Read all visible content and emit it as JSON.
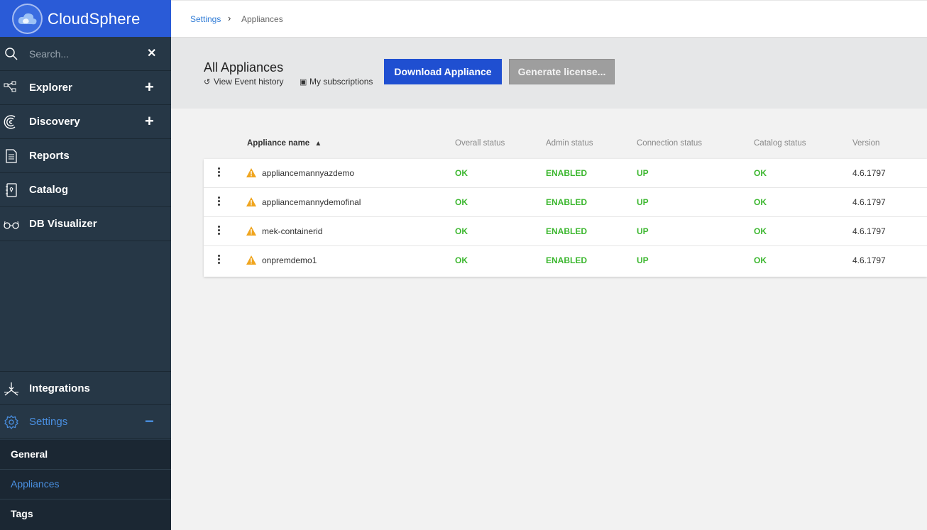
{
  "app": {
    "name": "CloudSphere",
    "accent": "#2a5bd7"
  },
  "sidebar": {
    "search_placeholder": "Search...",
    "items": [
      {
        "label": "Explorer",
        "icon": "explorer-icon"
      },
      {
        "label": "Discovery",
        "icon": "discovery-icon"
      },
      {
        "label": "Reports",
        "icon": "reports-icon"
      },
      {
        "label": "Catalog",
        "icon": "catalog-icon"
      },
      {
        "label": "DB Visualizer",
        "icon": "glasses-icon"
      }
    ],
    "bottom_items": [
      {
        "label": "Integrations",
        "icon": "integrations-icon"
      },
      {
        "label": "Settings",
        "icon": "gear-icon"
      }
    ],
    "settings_sub": [
      {
        "label": "General"
      },
      {
        "label": "Appliances"
      },
      {
        "label": "Tags"
      }
    ]
  },
  "breadcrumb": {
    "parent": "Settings",
    "current": "Appliances"
  },
  "toolbar": {
    "title": "All Appliances",
    "event_history": "View Event history",
    "subscriptions": "My subscriptions",
    "download_label": "Download Appliance",
    "license_label": "Generate license..."
  },
  "table": {
    "columns": [
      "Appliance name",
      "Overall status",
      "Admin status",
      "Connection status",
      "Catalog status",
      "Version"
    ],
    "rows": [
      {
        "name": "appliancemannyazdemo",
        "overall": "OK",
        "admin": "ENABLED",
        "connection": "UP",
        "catalog": "OK",
        "version": "4.6.1797"
      },
      {
        "name": "appliancemannydemofinal",
        "overall": "OK",
        "admin": "ENABLED",
        "connection": "UP",
        "catalog": "OK",
        "version": "4.6.1797"
      },
      {
        "name": "mek-containerid",
        "overall": "OK",
        "admin": "ENABLED",
        "connection": "UP",
        "catalog": "OK",
        "version": "4.6.1797"
      },
      {
        "name": "onpremdemo1",
        "overall": "OK",
        "admin": "ENABLED",
        "connection": "UP",
        "catalog": "OK",
        "version": "4.6.1797"
      }
    ]
  },
  "colors": {
    "status_ok": "#3cb72f",
    "warning": "#f0a51e",
    "link": "#2f7bd6"
  }
}
